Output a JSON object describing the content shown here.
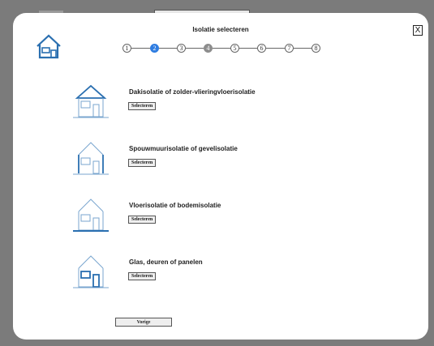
{
  "dialog": {
    "title": "Isolatie selecteren",
    "close_label": "X",
    "steps": [
      {
        "label": "1",
        "state": "default"
      },
      {
        "label": "2",
        "state": "active"
      },
      {
        "label": "3",
        "state": "default"
      },
      {
        "label": "4",
        "state": "done"
      },
      {
        "label": "5",
        "state": "default"
      },
      {
        "label": "6",
        "state": "default"
      },
      {
        "label": "7",
        "state": "default"
      },
      {
        "label": "8",
        "state": "default"
      }
    ],
    "options": [
      {
        "label": "Dakisolatie of zolder-vlieringvloerisolatie",
        "button": "Selecteren",
        "icon": "roof-insulation-icon"
      },
      {
        "label": "Spouwmuurisolatie of gevelisolatie",
        "button": "Selecteren",
        "icon": "wall-insulation-icon"
      },
      {
        "label": "Vloerisolatie of bodemisolatie",
        "button": "Selecteren",
        "icon": "floor-insulation-icon"
      },
      {
        "label": "Glas, deuren of panelen",
        "button": "Selecteren",
        "icon": "glass-door-icon"
      }
    ],
    "previous_label": "Vorige"
  },
  "colors": {
    "accent": "#2f7de1",
    "icon_blue": "#2a6fb0",
    "done_step": "#8d8d8d"
  }
}
